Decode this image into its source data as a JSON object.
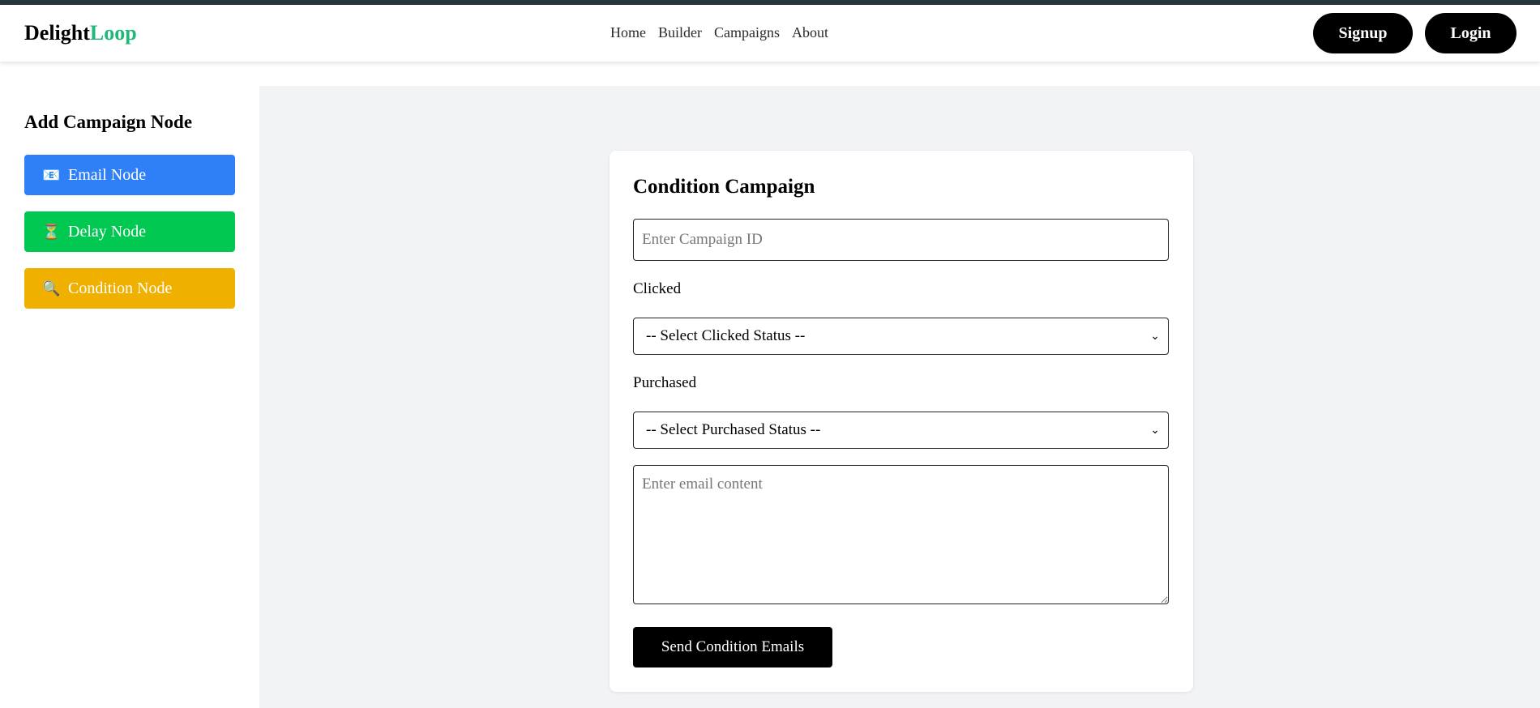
{
  "brand": {
    "part1": "Delight",
    "part2": "Loop",
    "accent_color": "#1fb77a"
  },
  "nav": {
    "links": [
      "Home",
      "Builder",
      "Campaigns",
      "About"
    ]
  },
  "auth": {
    "signup_label": "Signup",
    "login_label": "Login"
  },
  "sidebar": {
    "title": "Add Campaign Node",
    "items": [
      {
        "label": "Email Node",
        "icon": "email-icon",
        "glyph": "📧",
        "color": "#2f80f6"
      },
      {
        "label": "Delay Node",
        "icon": "hourglass-icon",
        "glyph": "⏳",
        "color": "#00c851"
      },
      {
        "label": "Condition Node",
        "icon": "magnifier-icon",
        "glyph": "🔍",
        "color": "#f0b000"
      }
    ]
  },
  "form": {
    "title": "Condition Campaign",
    "campaign_id": {
      "placeholder": "Enter Campaign ID",
      "value": ""
    },
    "clicked_label": "Clicked",
    "clicked_select": "-- Select Clicked Status --",
    "purchased_label": "Purchased",
    "purchased_select": "-- Select Purchased Status --",
    "email_content": {
      "placeholder": "Enter email content",
      "value": ""
    },
    "submit_label": "Send Condition Emails"
  }
}
